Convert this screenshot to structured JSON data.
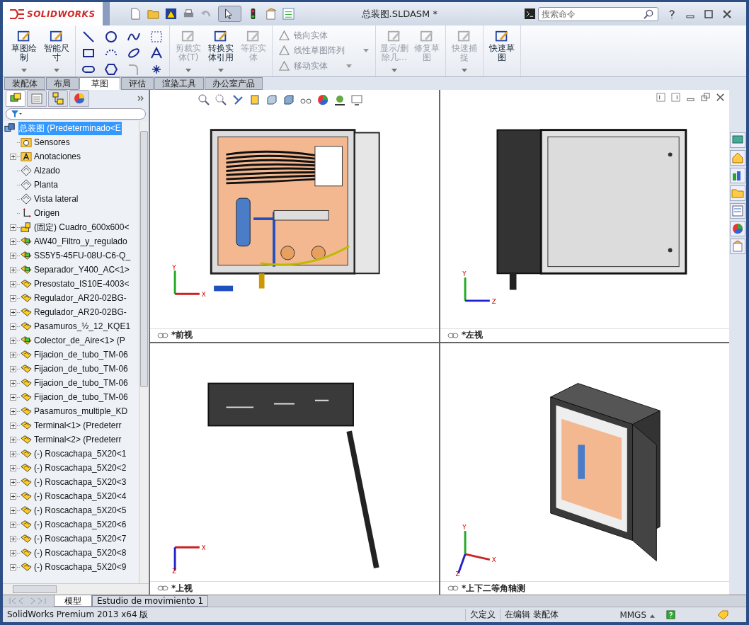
{
  "window": {
    "logo": "SOLIDWORKS",
    "title": "总装图.SLDASM *"
  },
  "search": {
    "placeholder": "搜索命令"
  },
  "ribbon": {
    "groups": [
      {
        "kind": "large",
        "items": [
          {
            "label": "草图绘制",
            "disabled": false,
            "dropdown": true
          },
          {
            "label": "智能尺寸",
            "disabled": false,
            "dropdown": true
          }
        ]
      },
      {
        "kind": "tools"
      },
      {
        "kind": "large",
        "items": [
          {
            "label": "剪裁实体(T)",
            "disabled": true,
            "dropdown": true
          },
          {
            "label": "转换实体引用",
            "disabled": false,
            "dropdown": true
          },
          {
            "label": "等距实体",
            "disabled": true,
            "dropdown": false
          }
        ]
      },
      {
        "kind": "small",
        "items": [
          {
            "label": "镜向实体",
            "disabled": true,
            "dropdown": false
          },
          {
            "label": "线性草图阵列",
            "disabled": true,
            "dropdown": true
          },
          {
            "label": "移动实体",
            "disabled": true,
            "dropdown": true
          }
        ]
      },
      {
        "kind": "large",
        "items": [
          {
            "label": "显示/删除几…",
            "disabled": true,
            "dropdown": true
          },
          {
            "label": "修复草图",
            "disabled": true,
            "dropdown": false
          }
        ]
      },
      {
        "kind": "large",
        "items": [
          {
            "label": "快速捕捉",
            "disabled": true,
            "dropdown": true
          }
        ]
      },
      {
        "kind": "large",
        "items": [
          {
            "label": "快速草图",
            "disabled": false,
            "dropdown": false
          }
        ]
      }
    ]
  },
  "tabs": [
    {
      "label": "装配体",
      "selected": false
    },
    {
      "label": "布局",
      "selected": false
    },
    {
      "label": "草图",
      "selected": true
    },
    {
      "label": "评估",
      "selected": false
    },
    {
      "label": "渲染工具",
      "selected": false
    },
    {
      "label": "办公室产品",
      "selected": false
    }
  ],
  "tree": {
    "root": {
      "label": "总装图  (Predeterminado<E",
      "selected": true,
      "children": [
        {
          "label": "Sensores",
          "kind": "sensor-folder",
          "expandable": false
        },
        {
          "label": "Anotaciones",
          "kind": "annotation-folder",
          "expandable": true
        },
        {
          "label": "Alzado",
          "kind": "plane",
          "expandable": false
        },
        {
          "label": "Planta",
          "kind": "plane",
          "expandable": false
        },
        {
          "label": "Vista lateral",
          "kind": "plane",
          "expandable": false
        },
        {
          "label": "Origen",
          "kind": "origin",
          "expandable": false
        },
        {
          "label": "(固定) Cuadro_600x600<",
          "kind": "fixed-part",
          "expandable": true
        },
        {
          "label": "AW40_Filtro_y_regulado",
          "kind": "subassembly",
          "expandable": true
        },
        {
          "label": "SS5Y5-45FU-08U-C6-Q_",
          "kind": "subassembly",
          "expandable": true
        },
        {
          "label": "Separador_Y400_AC<1>",
          "kind": "subassembly",
          "expandable": true
        },
        {
          "label": "Presostato_IS10E-4003<",
          "kind": "part",
          "expandable": true
        },
        {
          "label": "Regulador_AR20-02BG-",
          "kind": "part",
          "expandable": true
        },
        {
          "label": "Regulador_AR20-02BG-",
          "kind": "part",
          "expandable": true
        },
        {
          "label": "Pasamuros_½_12_KQE1",
          "kind": "part",
          "expandable": true
        },
        {
          "label": "Colector_de_Aire<1> (P",
          "kind": "subassembly",
          "expandable": true
        },
        {
          "label": "Fijacion_de_tubo_TM-06",
          "kind": "part",
          "expandable": true
        },
        {
          "label": "Fijacion_de_tubo_TM-06",
          "kind": "part",
          "expandable": true
        },
        {
          "label": "Fijacion_de_tubo_TM-06",
          "kind": "part",
          "expandable": true
        },
        {
          "label": "Fijacion_de_tubo_TM-06",
          "kind": "part",
          "expandable": true
        },
        {
          "label": "Pasamuros_multiple_KD",
          "kind": "part",
          "expandable": true
        },
        {
          "label": "Terminal<1> (Predeterr",
          "kind": "part",
          "expandable": true
        },
        {
          "label": "Terminal<2> (Predeterr",
          "kind": "part",
          "expandable": true
        },
        {
          "label": "(-) Roscachapa_5X20<1",
          "kind": "part",
          "expandable": true
        },
        {
          "label": "(-) Roscachapa_5X20<2",
          "kind": "part",
          "expandable": true
        },
        {
          "label": "(-) Roscachapa_5X20<3",
          "kind": "part",
          "expandable": true
        },
        {
          "label": "(-) Roscachapa_5X20<4",
          "kind": "part",
          "expandable": true
        },
        {
          "label": "(-) Roscachapa_5X20<5",
          "kind": "part",
          "expandable": true
        },
        {
          "label": "(-) Roscachapa_5X20<6",
          "kind": "part",
          "expandable": true
        },
        {
          "label": "(-) Roscachapa_5X20<7",
          "kind": "part",
          "expandable": true
        },
        {
          "label": "(-) Roscachapa_5X20<8",
          "kind": "part",
          "expandable": true
        },
        {
          "label": "(-) Roscachapa_5X20<9",
          "kind": "part",
          "expandable": true
        }
      ]
    }
  },
  "views": [
    {
      "label": "*前视",
      "kind": "front",
      "axes": [
        "Y",
        "X"
      ]
    },
    {
      "label": "*左视",
      "kind": "left",
      "axes": [
        "Y",
        "Z"
      ]
    },
    {
      "label": "*上视",
      "kind": "top",
      "axes": [
        "X",
        "Z"
      ]
    },
    {
      "label": "*上下二等角轴测",
      "kind": "iso",
      "axes": [
        "Y",
        "X",
        "Z"
      ]
    }
  ],
  "bottom_tabs": [
    {
      "label": "模型",
      "selected": true
    },
    {
      "label": "Estudio de movimiento 1",
      "selected": false
    }
  ],
  "status_bar": {
    "product": "SolidWorks Premium 2013 x64 版",
    "definition": "欠定义",
    "editing": "在编辑 装配体",
    "units": "MMGS"
  }
}
